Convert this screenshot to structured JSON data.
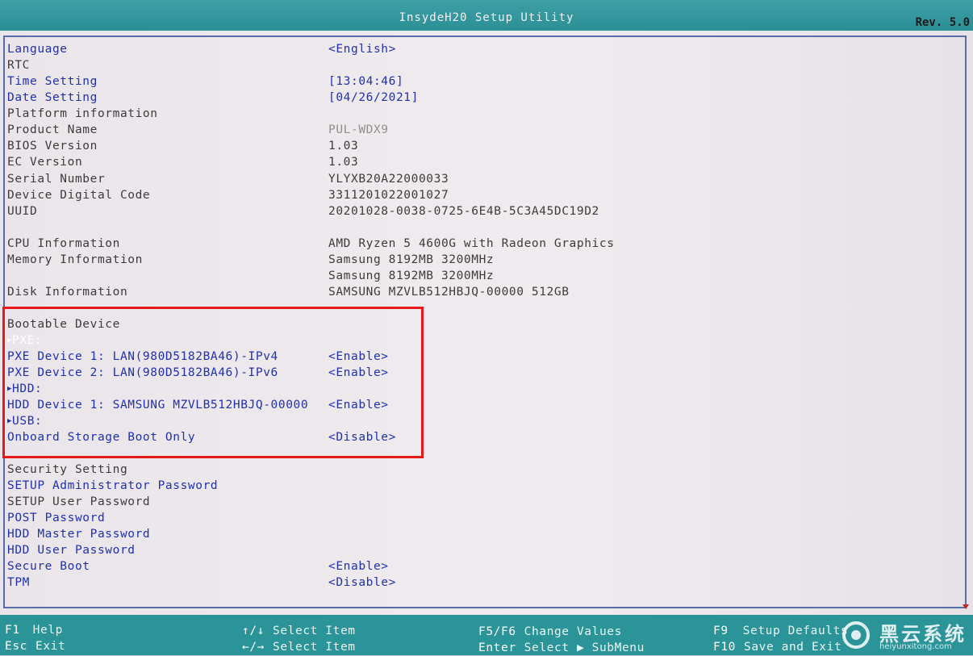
{
  "header": {
    "title": "InsydeH20 Setup Utility",
    "revision": "Rev. 5.0"
  },
  "rows": [
    {
      "label": "Language",
      "value": "<English>"
    },
    {
      "label": "RTC",
      "value": ""
    },
    {
      "label": "Time Setting",
      "value": "[13:04:46]"
    },
    {
      "label": "Date Setting",
      "value": "[04/26/2021]"
    },
    {
      "label": "Platform information",
      "value": ""
    },
    {
      "label": "Product Name",
      "value": "PUL-WDX9"
    },
    {
      "label": "BIOS Version",
      "value": "1.03"
    },
    {
      "label": "EC Version",
      "value": "1.03"
    },
    {
      "label": "Serial Number",
      "value": "YLYXB20A22000033"
    },
    {
      "label": "Device Digital Code",
      "value": "3311201022001027"
    },
    {
      "label": "UUID",
      "value": "20201028-0038-0725-6E4B-5C3A45DC19D2"
    },
    {
      "label": "CPU Information",
      "value": "AMD Ryzen 5 4600G with Radeon Graphics"
    },
    {
      "label": "Memory Information",
      "value": "Samsung 8192MB 3200MHz"
    },
    {
      "label": "",
      "value": "Samsung 8192MB 3200MHz"
    },
    {
      "label": "Disk Information",
      "value": "SAMSUNG MZVLB512HBJQ-00000 512GB"
    },
    {
      "label": "Bootable Device",
      "value": ""
    },
    {
      "label": "PXE:",
      "value": ""
    },
    {
      "label": "PXE Device 1: LAN(980D5182BA46)-IPv4",
      "value": "<Enable>"
    },
    {
      "label": "PXE Device 2: LAN(980D5182BA46)-IPv6",
      "value": "<Enable>"
    },
    {
      "label": "HDD:",
      "value": ""
    },
    {
      "label": "HDD Device 1: SAMSUNG MZVLB512HBJQ-00000",
      "value": "<Enable>"
    },
    {
      "label": "USB:",
      "value": ""
    },
    {
      "label": "Onboard Storage Boot Only",
      "value": "<Disable>"
    },
    {
      "label": "Security Setting",
      "value": ""
    },
    {
      "label": "SETUP Administrator Password",
      "value": ""
    },
    {
      "label": "SETUP User Password",
      "value": ""
    },
    {
      "label": "POST Password",
      "value": ""
    },
    {
      "label": "HDD Master Password",
      "value": ""
    },
    {
      "label": "HDD User Password",
      "value": ""
    },
    {
      "label": "Secure Boot",
      "value": "<Enable>"
    },
    {
      "label": "TPM",
      "value": "<Disable>"
    }
  ],
  "footer": {
    "f1": {
      "key": "F1",
      "desc": "Help"
    },
    "esc": {
      "key": "Esc",
      "desc": "Exit"
    },
    "updown": {
      "key": "↑/↓",
      "desc": "Select Item"
    },
    "leftright": {
      "key": "←/→",
      "desc": "Select Item"
    },
    "f5f6": {
      "key": "F5/F6",
      "desc": "Change Values"
    },
    "enter": {
      "key": "Enter",
      "desc": "Select ▶ SubMenu"
    },
    "f9": {
      "key": "F9",
      "desc": "Setup Defaults"
    },
    "f10": {
      "key": "F10",
      "desc": "Save and Exit"
    }
  },
  "watermark": {
    "name": "黑云系统",
    "url": "heiyunxitong.com"
  },
  "colors": {
    "title_bar": "#2b9499",
    "panel": "#ece8ec",
    "selectable_text": "#2130b0",
    "static_text": "#3c3c3c",
    "highlight_box": "#e81818"
  }
}
